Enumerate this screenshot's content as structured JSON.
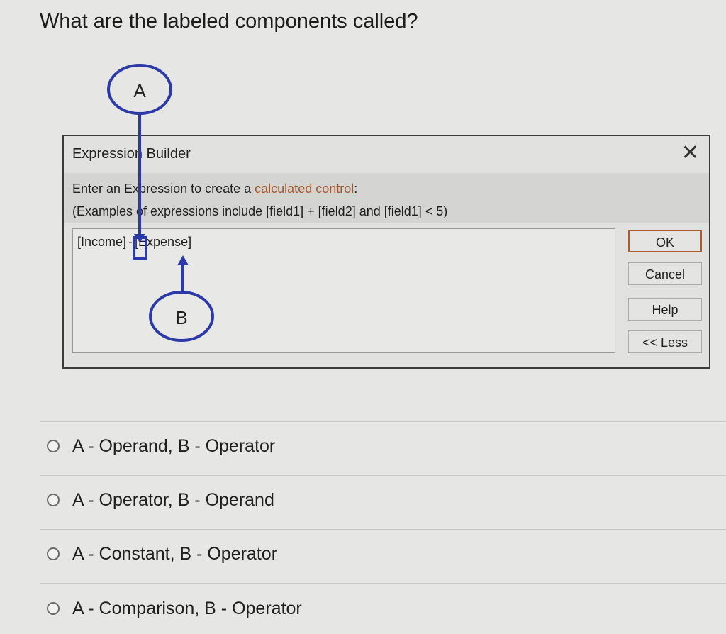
{
  "question": "What are the labeled components called?",
  "dialog": {
    "title": "Expression Builder",
    "close_glyph": "✕",
    "instruction_prefix": "Enter an Expression to create a ",
    "instruction_link": "calculated control",
    "instruction_suffix": ":",
    "examples": "(Examples of expressions include [field1] + [field2] and [field1] < 5)",
    "expression": {
      "left": "[Income]",
      "operator": "-",
      "right": "[Expense]"
    },
    "buttons": {
      "ok": "OK",
      "cancel": "Cancel",
      "help": "Help",
      "less": "<< Less"
    }
  },
  "annotations": {
    "label_a": "A",
    "label_b": "B",
    "color": "#2b3aa8"
  },
  "options": [
    "A - Operand, B - Operator",
    "A - Operator, B - Operand",
    "A - Constant, B - Operator",
    "A - Comparison, B - Operator"
  ]
}
